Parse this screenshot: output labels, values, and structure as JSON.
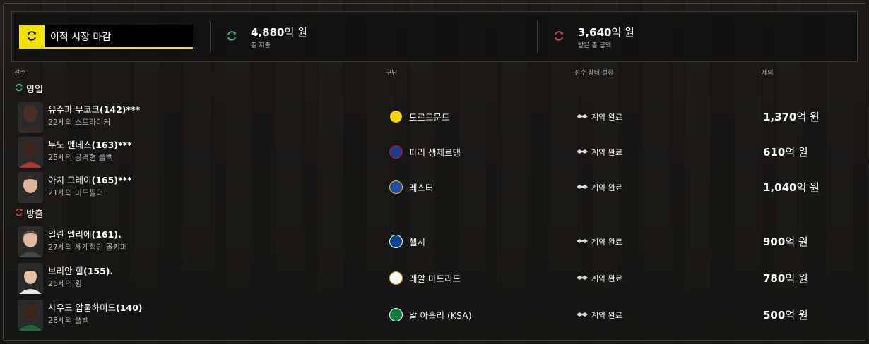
{
  "summary": {
    "deadline_label": "이적 시장 마감",
    "spent": {
      "value": "4,880",
      "unit": "억 원",
      "label": "총 지출"
    },
    "received": {
      "value": "3,640",
      "unit": "억 원",
      "label": "받은 총 금액"
    }
  },
  "columns": {
    "player": "선수",
    "club": "구단",
    "status": "선수 상태 설정",
    "offer": "제의"
  },
  "sections": {
    "incoming": "영입",
    "outgoing": "방출"
  },
  "incoming": [
    {
      "name_kr": "유수파 무코코",
      "name_tail": "(142)***",
      "desc": "22세의 스트라이커",
      "club": "도르트문트",
      "club_icon": "dortmund-crest-icon",
      "status": "계약 완료",
      "fee": "1,370",
      "fee_unit": "억 원"
    },
    {
      "name_kr": "누노 멘데스",
      "name_tail": "(163)***",
      "desc": "25세의 공격형 풀백",
      "club": "파리 생제르맹",
      "club_icon": "psg-crest-icon",
      "status": "계약 완료",
      "fee": "610",
      "fee_unit": "억 원"
    },
    {
      "name_kr": "아치 그레이",
      "name_tail": "(165)***",
      "desc": "21세의 미드필더",
      "club": "레스터",
      "club_icon": "leicester-crest-icon",
      "status": "계약 완료",
      "fee": "1,040",
      "fee_unit": "억 원"
    }
  ],
  "outgoing": [
    {
      "name_kr": "일란 멜리에",
      "name_tail": "(161).",
      "desc": "27세의 세계적인 골키퍼",
      "club": "첼시",
      "club_icon": "chelsea-crest-icon",
      "status": "계약 완료",
      "fee": "900",
      "fee_unit": "억 원"
    },
    {
      "name_kr": "브리안 힐",
      "name_tail": "(155).",
      "desc": "26세의 윙",
      "club": "레알 마드리드",
      "club_icon": "real-madrid-crest-icon",
      "status": "계약 완료",
      "fee": "780",
      "fee_unit": "억 원"
    },
    {
      "name_kr": "사우드 압둘하미드",
      "name_tail": "(140)",
      "desc": "28세의 풀백",
      "club": "알 아흘리 (KSA)",
      "club_icon": "al-ahli-crest-icon",
      "status": "계약 완료",
      "fee": "500",
      "fee_unit": "억 원"
    }
  ],
  "colors": {
    "accent": "#f2e100",
    "incoming": "#3fbf7f",
    "outgoing": "#e04848"
  }
}
